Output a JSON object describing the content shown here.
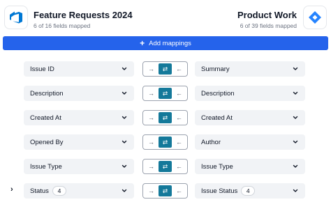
{
  "left_app": {
    "name": "Feature Requests 2024",
    "subtitle": "6 of 16 fields mapped",
    "logo_icon": "azure-devops-icon",
    "brand_color": "#0078d4"
  },
  "right_app": {
    "name": "Product Work",
    "subtitle": "6 of 39 fields mapped",
    "logo_icon": "jira-icon",
    "brand_color": "#2684ff"
  },
  "add_button": {
    "label": "Add mappings",
    "color": "#2563eb"
  },
  "direction_icons": {
    "left_to_right": "→",
    "bidirectional": "⇄",
    "right_to_left": "←",
    "active_color": "#14799a"
  },
  "mappings": [
    {
      "left": "Issue ID",
      "right": "Summary",
      "direction": "bidirectional"
    },
    {
      "left": "Description",
      "right": "Description",
      "direction": "bidirectional"
    },
    {
      "left": "Created At",
      "right": "Created At",
      "direction": "bidirectional"
    },
    {
      "left": "Opened By",
      "right": "Author",
      "direction": "bidirectional"
    },
    {
      "left": "Issue Type",
      "right": "Issue Type",
      "direction": "bidirectional"
    },
    {
      "left": "Status",
      "left_badge": "4",
      "right": "Issue Status",
      "right_badge": "4",
      "direction": "bidirectional",
      "expandable": true
    }
  ]
}
